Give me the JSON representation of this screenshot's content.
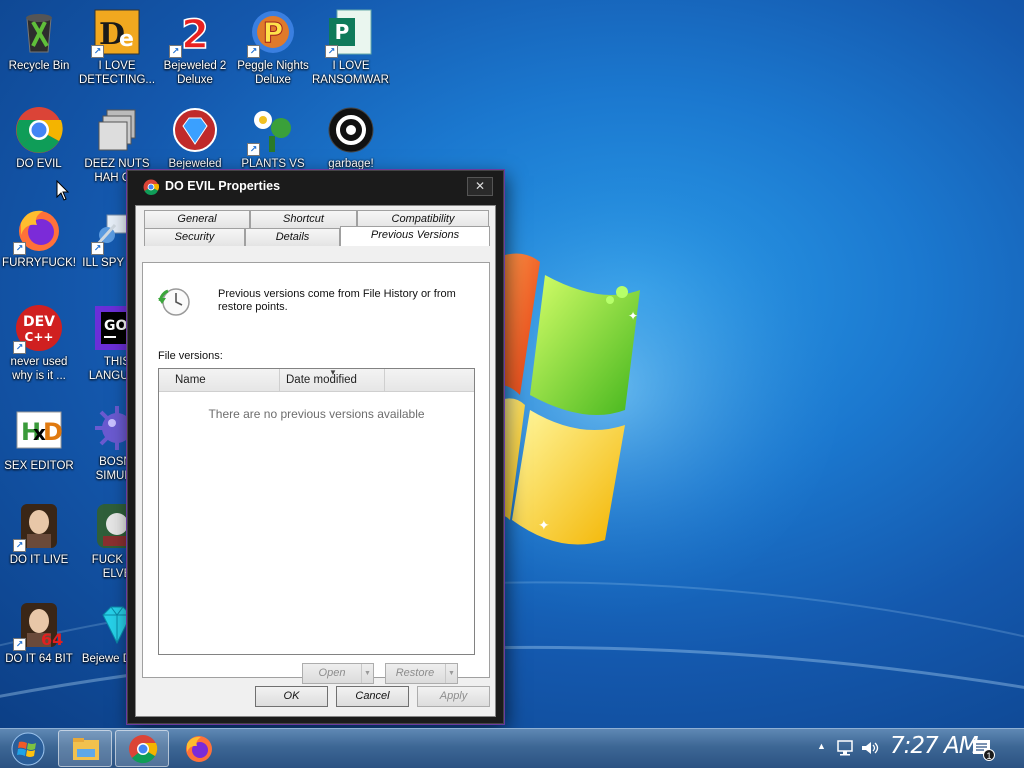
{
  "desktop": {
    "icons": [
      {
        "id": "recycle-bin",
        "label": "Recycle Bin"
      },
      {
        "id": "i-love-detecting",
        "label": "I LOVE DETECTING..."
      },
      {
        "id": "bejeweled-2",
        "label": "Bejeweled 2 Deluxe"
      },
      {
        "id": "peggle-nights",
        "label": "Peggle Nights Deluxe"
      },
      {
        "id": "ransomware",
        "label": "I LOVE RANSOMWARE"
      },
      {
        "id": "do-evil",
        "label": "DO EVIL"
      },
      {
        "id": "deez-nuts",
        "label": "DEEZ NUTS HAH GO"
      },
      {
        "id": "bejeweled",
        "label": "Bejeweled"
      },
      {
        "id": "plants-vs",
        "label": "PLANTS VS"
      },
      {
        "id": "garbage",
        "label": "garbage!"
      },
      {
        "id": "furryfuck",
        "label": "FURRYFUCK!"
      },
      {
        "id": "ill-spy",
        "label": "ILL SPY YOU"
      },
      {
        "id": "never-used",
        "label": "never used why is it ..."
      },
      {
        "id": "this-language",
        "label": "THIS LANGUAG"
      },
      {
        "id": "sex-editor",
        "label": "SEX EDITOR"
      },
      {
        "id": "bosni-simula",
        "label": "BOSNI SIMULA"
      },
      {
        "id": "do-it-live",
        "label": "DO IT LIVE"
      },
      {
        "id": "fuck-sc-elve",
        "label": "FUCK SC ELVE"
      },
      {
        "id": "do-it-64",
        "label": "DO IT 64 BIT"
      },
      {
        "id": "bejewe-deluxe",
        "label": "Bejewe Delux"
      }
    ]
  },
  "dialog": {
    "title": "DO EVIL Properties",
    "close": "✕",
    "tabs_row1": [
      "General",
      "Shortcut",
      "Compatibility"
    ],
    "tabs_row2": [
      "Security",
      "Details",
      "Previous Versions"
    ],
    "info_text": "Previous versions come from File History or from restore points.",
    "file_versions_label": "File versions:",
    "columns": [
      "Name",
      "Date modified"
    ],
    "empty_message": "There are no previous versions available",
    "open_label": "Open",
    "restore_label": "Restore",
    "ok_label": "OK",
    "cancel_label": "Cancel",
    "apply_label": "Apply"
  },
  "taskbar": {
    "clock": "7:27 AM",
    "notification_count": "1"
  },
  "colors": {
    "desktop_blue": "#1b78cf",
    "dialog_frame": "#1b1b1b",
    "taskbar": "#3d6795"
  }
}
